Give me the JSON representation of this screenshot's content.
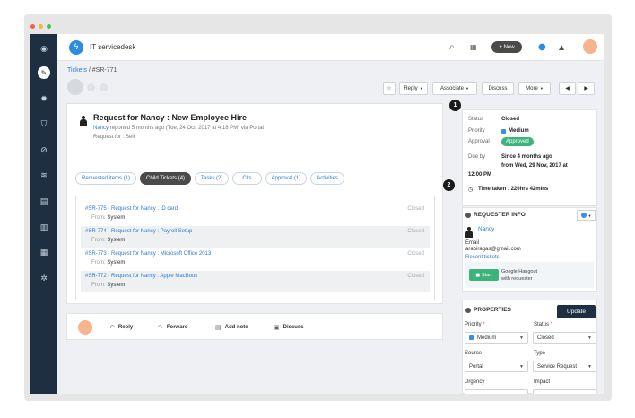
{
  "app": {
    "title": "IT servicedesk",
    "new_label": "+ New"
  },
  "breadcrumb": {
    "root": "Tickets",
    "separator": " / ",
    "current": "#SR-771"
  },
  "toolbar": {
    "reply": "Reply",
    "associate": "Associate",
    "discuss": "Discuss",
    "more": "More"
  },
  "ticket": {
    "subject": "Request for Nancy : New Employee Hire",
    "requester": "Nancy",
    "meta": " reported 5 months ago (Tue, 24 Oct, 2017 at 4:18 PM) via Portal",
    "request_for": "Request for : Self"
  },
  "tabs": [
    {
      "label": "Requested items (1)"
    },
    {
      "label": "Child Tickets (4)"
    },
    {
      "label": "Tasks (2)"
    },
    {
      "label": "CI's"
    },
    {
      "label": "Approval (1)"
    },
    {
      "label": "Activities"
    }
  ],
  "child_tickets": [
    {
      "title": "#SR-775 - Request for Nancy : ID card",
      "from_label": "From: ",
      "from": "System",
      "status": "Closed"
    },
    {
      "title": "#SR-774 - Request for Nancy : Payroll Setup",
      "from_label": "From: ",
      "from": "System",
      "status": "Closed"
    },
    {
      "title": "#SR-773 - Request for Nancy : Microsoft Office 2013",
      "from_label": "From: ",
      "from": "System",
      "status": "Closed"
    },
    {
      "title": "#SR-772 - Request for Nancy : Apple MacBook",
      "from_label": "From: ",
      "from": "System",
      "status": "Closed"
    }
  ],
  "actions": {
    "reply": "Reply",
    "forward": "Forward",
    "add_note": "Add note",
    "discuss": "Discuss"
  },
  "badges": {
    "one": "1",
    "two": "2"
  },
  "status_card": {
    "status_label": "Status",
    "status_value": "Closed",
    "priority_label": "Priority",
    "priority_value": "Medium",
    "approval_label": "Approval",
    "approval_value": "Approved",
    "due_label": "Due by",
    "due_line1": "Since 4 months ago",
    "due_line2": "from Wed, 29 Nov, 2017 at",
    "due_line3": "12:00 PM",
    "time_taken": "Time taken : 220hrs 42mins"
  },
  "requester_info": {
    "title": "REQUESTER INFO",
    "name": "Nancy",
    "email_label": "Email",
    "email": "arabiragas@gmail.com",
    "recent": "Recent tickets",
    "start_label": "Start",
    "hangout_line1": "Google Hangout",
    "hangout_line2": "with requester"
  },
  "properties": {
    "title": "PROPERTIES",
    "update": "Update",
    "priority_label": "Priority",
    "priority_value": "Medium",
    "status_label": "Status",
    "status_value": "Closed",
    "source_label": "Source",
    "source_value": "Portal",
    "type_label": "Type",
    "type_value": "Service Request",
    "urgency_label": "Urgency",
    "impact_label": "Impact"
  },
  "colors": {
    "sidebar": "#1f2f42",
    "accent": "#2c7bd0",
    "approved": "#3bb37b",
    "avatar": "#f6b48f"
  }
}
